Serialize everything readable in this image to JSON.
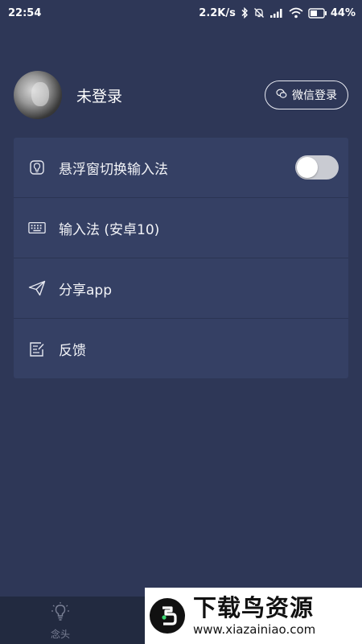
{
  "status_bar": {
    "time": "22:54",
    "net_speed": "2.2K/s",
    "battery": "44%"
  },
  "profile": {
    "name": "未登录",
    "wechat_login_label": "微信登录"
  },
  "menu": {
    "items": [
      {
        "label": "悬浮窗切换输入法",
        "icon": "bulb-icon",
        "has_toggle": true,
        "toggle_on": false
      },
      {
        "label": "输入法 (安卓10)",
        "icon": "keyboard-icon"
      },
      {
        "label": "分享app",
        "icon": "send-icon"
      },
      {
        "label": "反馈",
        "icon": "feedback-icon"
      }
    ]
  },
  "bottom_nav": {
    "tabs": [
      {
        "label": "念头",
        "icon": "bulb-icon"
      }
    ]
  },
  "watermark": {
    "title": "下载鸟资源",
    "url": "www.xiazainiao.com"
  },
  "colors": {
    "background": "#2e3757",
    "card": "#354064",
    "bottom_bar": "#222a40",
    "toggle_off": "#c9cbd2"
  }
}
